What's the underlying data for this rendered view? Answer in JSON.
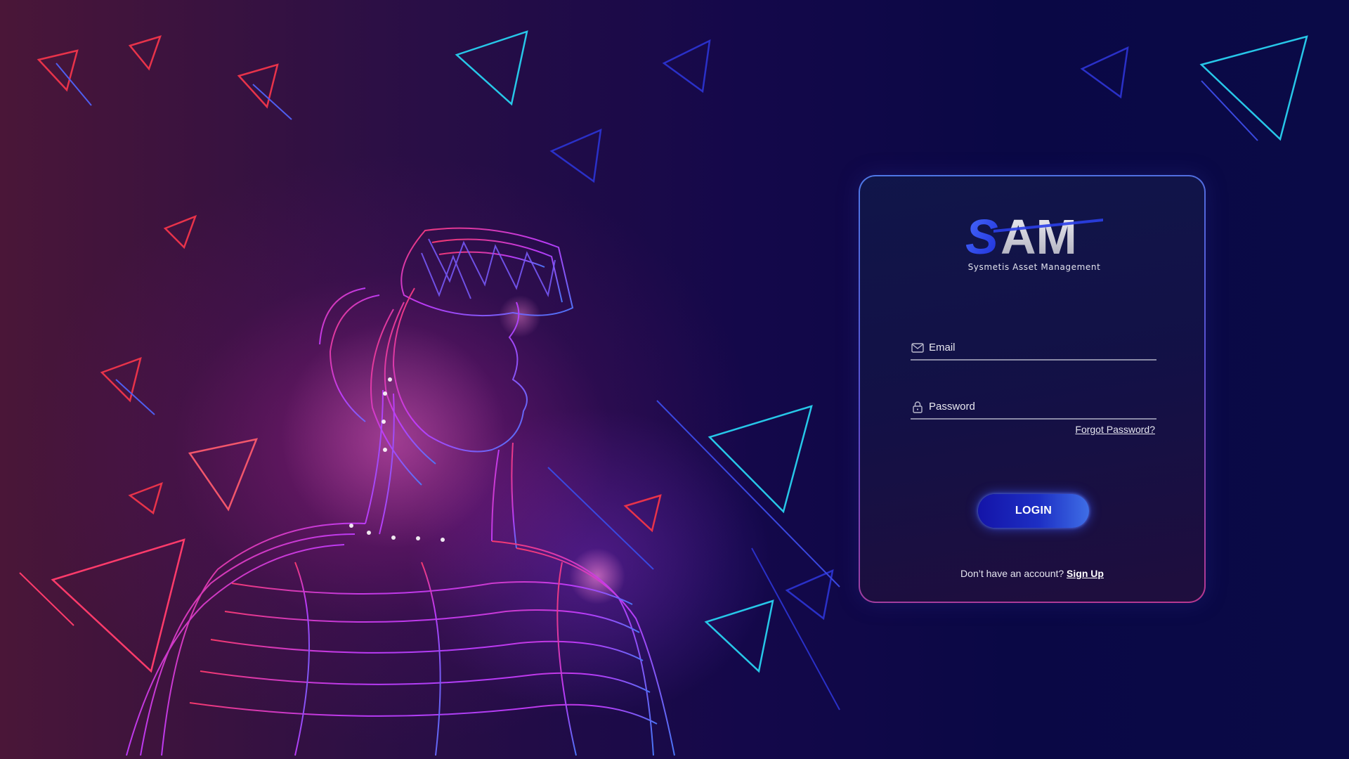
{
  "logo": {
    "text": "SAM",
    "tagline": "Sysmetis Asset Management"
  },
  "form": {
    "email_placeholder": "Email",
    "password_placeholder": "Password",
    "forgot_label": "Forgot Password?",
    "login_label": "LOGIN",
    "signup_prompt": "Don’t have an account?",
    "signup_label": "Sign Up"
  },
  "icons": {
    "email": "mail-icon",
    "password": "lock-icon"
  },
  "colors": {
    "card_border_top": "#4e78e6",
    "card_border_bottom": "#b8378f",
    "button": "#1d2fc4",
    "background_left": "#4a1638",
    "background_right": "#0a0a47"
  }
}
